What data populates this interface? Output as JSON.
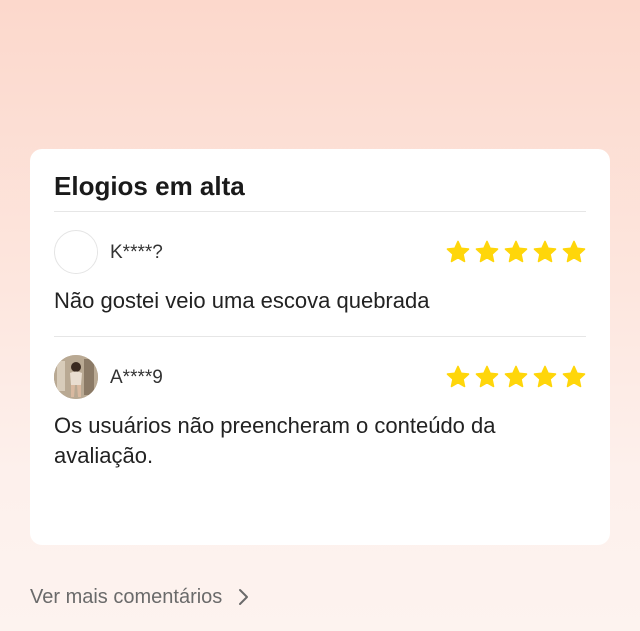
{
  "section": {
    "title": "Elogios em alta"
  },
  "reviews": [
    {
      "username": "K****?",
      "rating": 5,
      "max_rating": 5,
      "text": "Não gostei veio uma escova quebrada",
      "avatar": "default-avatar"
    },
    {
      "username": "A****9",
      "rating": 5,
      "max_rating": 5,
      "text": "Os usuários não preencheram o conteúdo da avaliação.",
      "avatar": "user-photo-avatar"
    }
  ],
  "footer": {
    "more_label": "Ver mais comentários",
    "icon": "chevron-right-icon"
  },
  "colors": {
    "star": "#ffd60a",
    "card_bg": "#ffffff",
    "page_bg_top": "#fcd8cc",
    "page_bg_bottom": "#fdf3ef",
    "link_text": "#6a6a6a"
  }
}
